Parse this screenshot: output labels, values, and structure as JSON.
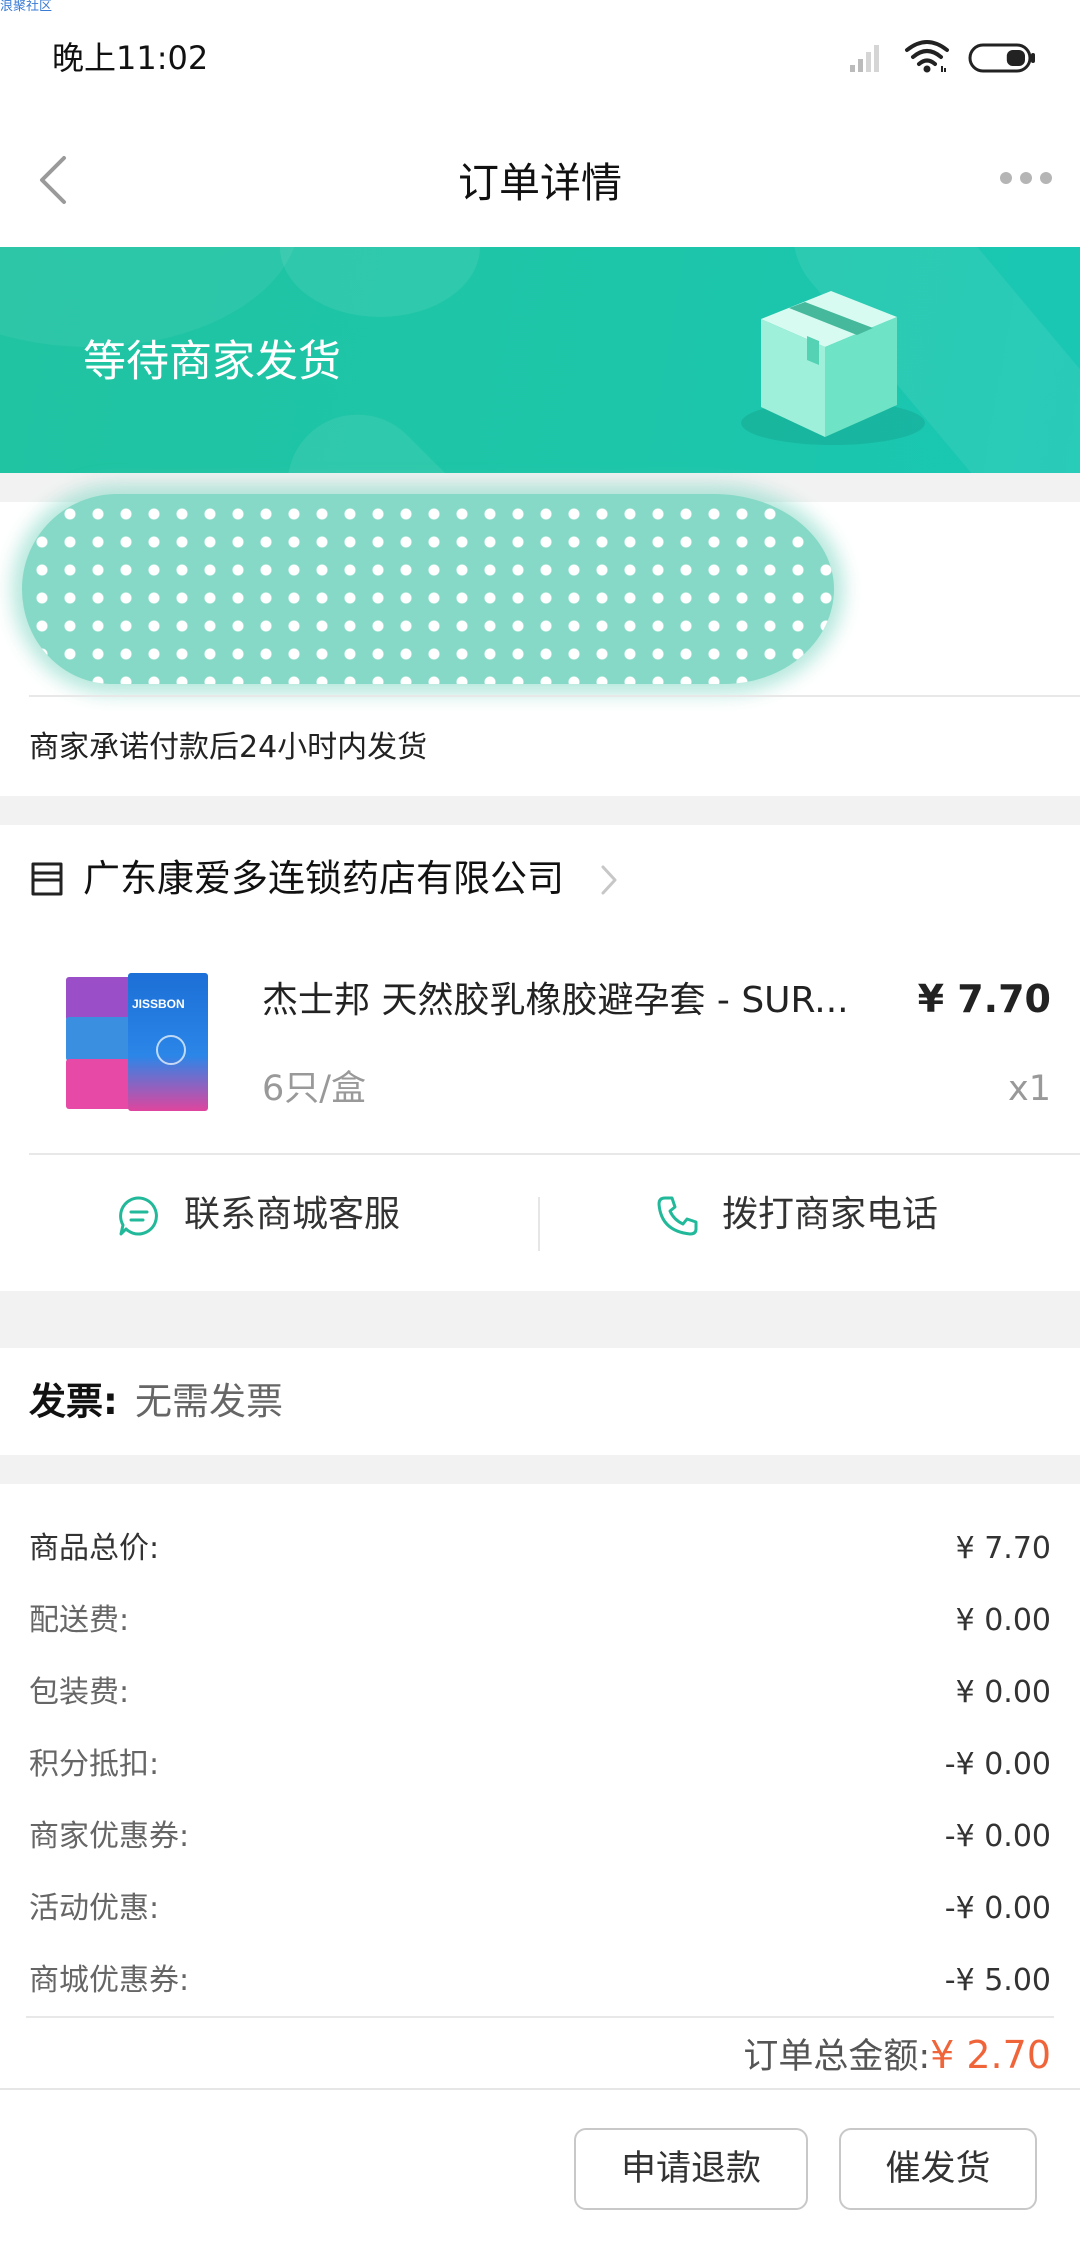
{
  "watermark": "浪聚社区",
  "status_bar": {
    "time": "晚上11:02",
    "icons": [
      "signal-icon",
      "wifi-icon",
      "battery-icon"
    ],
    "battery_level": 0.35
  },
  "nav": {
    "title": "订单详情",
    "back_icon": "chevron-left-icon",
    "more_icon": "more-icon"
  },
  "banner": {
    "status_text": "等待商家发货",
    "illustration": "package-box-icon"
  },
  "shipping_promise": "商家承诺付款后24小时内发货",
  "shop": {
    "name": "广东康爱多连锁药店有限公司",
    "icon": "store-icon"
  },
  "product": {
    "title": "杰士邦 天然胶乳橡胶避孕套 - SUR...",
    "price": "¥ 7.70",
    "spec": "6只/盒",
    "quantity": "x1",
    "logo_text": "JISSBON"
  },
  "actions": {
    "contact_service": "联系商城客服",
    "call_merchant": "拨打商家电话"
  },
  "invoice": {
    "label": "发票:",
    "value": "无需发票"
  },
  "fees": [
    {
      "label": "商品总价:",
      "value": "¥ 7.70"
    },
    {
      "label": "配送费:",
      "value": "¥ 0.00"
    },
    {
      "label": "包装费:",
      "value": "¥ 0.00"
    },
    {
      "label": "积分抵扣:",
      "value": "-¥ 0.00"
    },
    {
      "label": "商家优惠券:",
      "value": "-¥ 0.00"
    },
    {
      "label": "活动优惠:",
      "value": "-¥ 0.00"
    },
    {
      "label": "商城优惠券:",
      "value": "-¥ 5.00"
    }
  ],
  "total": {
    "label": "订单总金额:",
    "value": "¥ 2.70"
  },
  "footer": {
    "refund_button": "申请退款",
    "urge_button": "催发货"
  },
  "colors": {
    "accent": "#1fc3a5",
    "total_highlight": "#f0643a",
    "background": "#f2f2f2"
  }
}
